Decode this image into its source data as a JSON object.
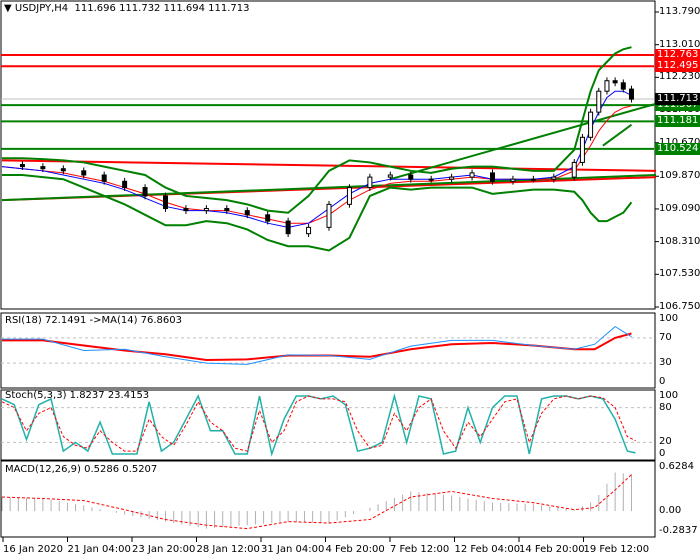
{
  "header": {
    "symbol": "USDJPY,H4",
    "ohlc": "111.696 111.732 111.694 111.713"
  },
  "colors": {
    "up": "#008000",
    "down": "#ff0000",
    "ma_fast": "#0000ff",
    "ma_slow": "#ff0000",
    "rsi": "#1e90ff",
    "stoch": "#20b2aa"
  },
  "chart_data": [
    {
      "type": "line",
      "title": "USDJPY,H4",
      "ylim": [
        106.75,
        113.79
      ],
      "yticks": [
        "113.790",
        "113.010",
        "112.230",
        "111.450",
        "110.670",
        "109.870",
        "109.090",
        "108.310",
        "107.530",
        "106.750"
      ],
      "xticks": [
        "16 Jan 2020",
        "21 Jan 04:00",
        "23 Jan 20:00",
        "28 Jan 12:00",
        "31 Jan 04:00",
        "4 Feb 20:00",
        "7 Feb 12:00",
        "12 Feb 04:00",
        "14 Feb 20:00",
        "19 Feb 12:00"
      ],
      "current_price": "111.713",
      "levels": [
        {
          "value": "112.763",
          "color": "#ff0000"
        },
        {
          "value": "112.495",
          "color": "#ff0000"
        },
        {
          "value": "111.567",
          "color": "#008000"
        },
        {
          "value": "111.181",
          "color": "#008000"
        },
        {
          "value": "110.524",
          "color": "#008000"
        }
      ],
      "x": [
        0,
        5,
        10,
        15,
        20,
        25,
        30,
        35,
        40,
        45,
        50,
        55,
        60,
        65,
        70,
        75,
        80,
        85,
        90,
        95,
        100,
        105,
        110,
        115,
        120,
        125,
        130,
        135,
        140,
        142,
        144,
        146,
        148,
        150,
        152,
        154
      ],
      "close": [
        110.15,
        110.1,
        110.05,
        110.0,
        109.9,
        109.75,
        109.6,
        109.4,
        109.1,
        109.05,
        109.1,
        109.05,
        108.95,
        108.8,
        108.5,
        108.65,
        109.2,
        109.6,
        109.85,
        109.9,
        109.8,
        109.8,
        109.85,
        109.95,
        109.75,
        109.8,
        109.8,
        109.85,
        110.2,
        110.8,
        111.4,
        111.9,
        112.15,
        112.1,
        111.95,
        111.71
      ],
      "bb_upper": [
        110.3,
        110.3,
        110.28,
        110.25,
        110.2,
        110.1,
        110.0,
        109.9,
        109.6,
        109.4,
        109.35,
        109.3,
        109.2,
        109.05,
        109.0,
        109.4,
        110.0,
        110.25,
        110.2,
        110.1,
        110.0,
        109.95,
        110.05,
        110.1,
        110.1,
        110.05,
        110.0,
        110.0,
        110.5,
        111.2,
        111.9,
        112.4,
        112.6,
        112.8,
        112.9,
        112.95
      ],
      "bb_lower": [
        109.9,
        109.9,
        109.85,
        109.8,
        109.6,
        109.4,
        109.2,
        108.95,
        108.7,
        108.7,
        108.8,
        108.75,
        108.6,
        108.35,
        108.2,
        108.2,
        108.1,
        108.4,
        109.4,
        109.6,
        109.55,
        109.6,
        109.6,
        109.6,
        109.45,
        109.5,
        109.55,
        109.55,
        109.5,
        109.3,
        109.0,
        108.8,
        108.8,
        108.9,
        109.0,
        109.25
      ],
      "ma_fast": [
        110.1,
        110.05,
        110.0,
        109.9,
        109.8,
        109.7,
        109.55,
        109.35,
        109.15,
        109.05,
        109.05,
        109.0,
        108.9,
        108.75,
        108.65,
        108.75,
        109.1,
        109.45,
        109.7,
        109.8,
        109.8,
        109.8,
        109.85,
        109.9,
        109.8,
        109.8,
        109.8,
        109.85,
        110.1,
        110.5,
        111.0,
        111.4,
        111.75,
        111.9,
        111.9,
        111.8
      ],
      "ma_slow": [
        110.1,
        110.05,
        110.0,
        109.95,
        109.85,
        109.75,
        109.6,
        109.45,
        109.25,
        109.1,
        109.05,
        109.05,
        108.95,
        108.85,
        108.75,
        108.75,
        108.95,
        109.3,
        109.55,
        109.7,
        109.75,
        109.75,
        109.8,
        109.85,
        109.8,
        109.8,
        109.8,
        109.8,
        110.0,
        110.3,
        110.6,
        110.95,
        111.2,
        111.4,
        111.5,
        111.55
      ],
      "trendlines": [
        {
          "x": [
            0,
            160
          ],
          "y": [
            110.25,
            110.0
          ],
          "color": "#ff0000"
        },
        {
          "x": [
            0,
            160
          ],
          "y": [
            109.3,
            109.85
          ],
          "color": "#ff0000"
        },
        {
          "x": [
            0,
            160
          ],
          "y": [
            109.3,
            109.9
          ],
          "color": "#008000"
        },
        {
          "x": [
            95,
            160
          ],
          "y": [
            109.8,
            111.6
          ],
          "color": "#008000"
        },
        {
          "x": [
            147,
            154
          ],
          "y": [
            110.6,
            111.1
          ],
          "color": "#008000"
        }
      ]
    },
    {
      "type": "line",
      "title": "RSI(18) 72.1491  ->MA(14) 76.8603",
      "ylim": [
        0,
        100
      ],
      "yticks": [
        "100",
        "70",
        "30",
        "0"
      ],
      "x": [
        0,
        10,
        20,
        30,
        40,
        50,
        60,
        70,
        80,
        90,
        100,
        110,
        120,
        130,
        140,
        145,
        150,
        154
      ],
      "rsi": [
        68,
        68,
        50,
        52,
        40,
        30,
        28,
        43,
        42,
        36,
        57,
        66,
        66,
        58,
        52,
        60,
        88,
        72
      ],
      "ma": [
        66,
        66,
        58,
        50,
        44,
        35,
        36,
        42,
        42,
        40,
        52,
        60,
        62,
        58,
        52,
        52,
        70,
        77
      ]
    },
    {
      "type": "line",
      "title": "Stoch(5,3,3) 1.8237 23.4153",
      "ylim": [
        0,
        100
      ],
      "yticks": [
        "100",
        "80",
        "20",
        "0"
      ],
      "x": [
        0,
        3,
        6,
        9,
        12,
        15,
        18,
        21,
        24,
        27,
        30,
        33,
        36,
        39,
        42,
        45,
        48,
        51,
        54,
        57,
        60,
        63,
        66,
        69,
        72,
        75,
        78,
        81,
        84,
        87,
        90,
        93,
        96,
        99,
        102,
        105,
        108,
        111,
        114,
        117,
        120,
        123,
        126,
        129,
        132,
        135,
        138,
        141,
        144,
        147,
        150,
        153,
        155
      ],
      "k": [
        95,
        85,
        25,
        85,
        95,
        5,
        20,
        5,
        55,
        0,
        0,
        0,
        90,
        5,
        20,
        60,
        100,
        40,
        40,
        0,
        0,
        100,
        0,
        60,
        100,
        100,
        95,
        100,
        85,
        5,
        10,
        20,
        100,
        20,
        100,
        95,
        0,
        5,
        80,
        20,
        80,
        100,
        100,
        0,
        95,
        100,
        100,
        95,
        100,
        95,
        60,
        5,
        2
      ],
      "d": [
        90,
        80,
        40,
        70,
        80,
        30,
        15,
        10,
        40,
        20,
        5,
        5,
        60,
        30,
        15,
        50,
        90,
        55,
        40,
        10,
        5,
        75,
        20,
        40,
        90,
        100,
        95,
        95,
        90,
        40,
        10,
        15,
        70,
        40,
        80,
        95,
        40,
        10,
        55,
        30,
        60,
        90,
        95,
        20,
        70,
        95,
        100,
        95,
        100,
        97,
        80,
        30,
        23
      ]
    },
    {
      "type": "bar",
      "title": "MACD(12,26,9) 0.5286 0.5207",
      "ylim": [
        -0.2837,
        0.6284
      ],
      "yticks": [
        "0.6284",
        "0.00",
        "-0.2837"
      ],
      "x": [
        0,
        10,
        20,
        30,
        40,
        50,
        60,
        70,
        80,
        90,
        100,
        110,
        120,
        130,
        140,
        145,
        150,
        154
      ],
      "histogram": [
        0.2,
        0.18,
        0.08,
        -0.05,
        -0.15,
        -0.25,
        -0.2,
        -0.15,
        -0.18,
        0.05,
        0.28,
        0.22,
        0.12,
        0.1,
        0.02,
        0.15,
        0.55,
        0.53
      ],
      "signal": [
        0.2,
        0.18,
        0.15,
        0.02,
        -0.12,
        -0.2,
        -0.25,
        -0.15,
        -0.17,
        -0.12,
        0.2,
        0.28,
        0.18,
        0.12,
        0.02,
        0.05,
        0.3,
        0.52
      ]
    }
  ]
}
